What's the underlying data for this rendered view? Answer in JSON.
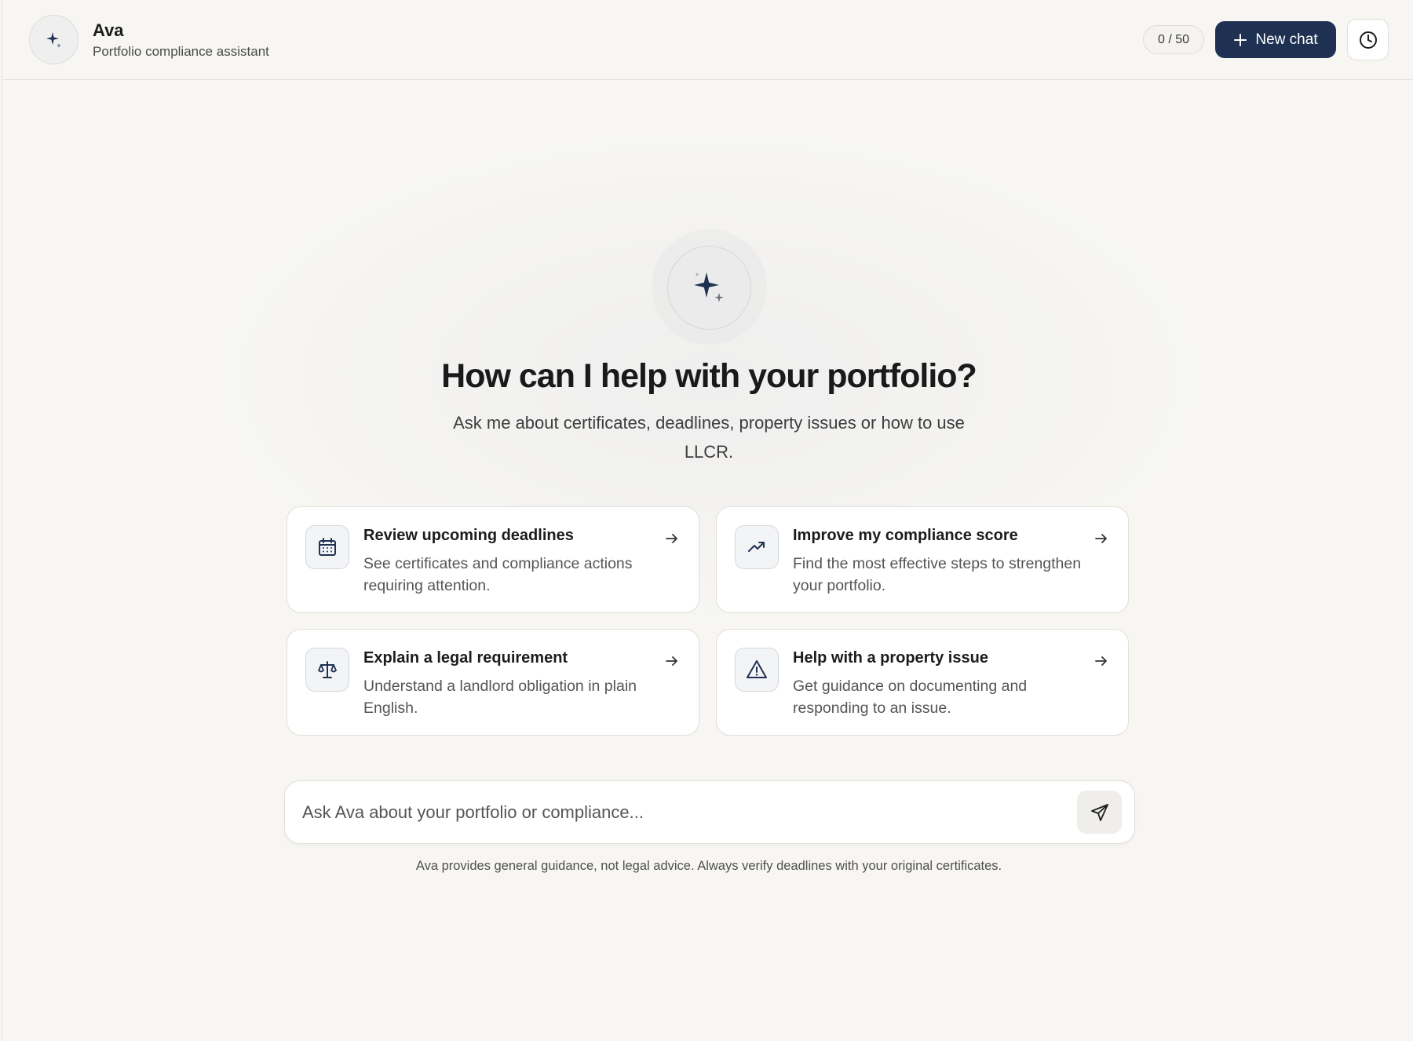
{
  "header": {
    "title": "Ava",
    "subtitle": "Portfolio compliance assistant",
    "counter": "0 / 50",
    "new_chat_label": "New chat",
    "icons": {
      "avatar": "sparkle-icon",
      "new_chat": "plus-icon",
      "history": "clock-icon"
    }
  },
  "hero": {
    "title": "How can I help with your portfolio?",
    "subtitle": "Ask me about certificates, deadlines, property issues or how to use LLCR."
  },
  "suggestions": [
    {
      "title": "Review upcoming deadlines",
      "description": "See certificates and compliance actions requiring attention.",
      "icon": "calendar-icon"
    },
    {
      "title": "Improve my compliance score",
      "description": "Find the most effective steps to strengthen your portfolio.",
      "icon": "trending-up-icon"
    },
    {
      "title": "Explain a legal requirement",
      "description": "Understand a landlord obligation in plain English.",
      "icon": "scale-icon"
    },
    {
      "title": "Help with a property issue",
      "description": "Get guidance on documenting and responding to an issue.",
      "icon": "warning-icon"
    }
  ],
  "composer": {
    "placeholder": "Ask Ava about your portfolio or compliance...",
    "send_icon": "send-icon"
  },
  "disclaimer": "Ava provides general guidance, not legal advice. Always verify deadlines with your original certificates.",
  "colors": {
    "accent": "#1f3152",
    "background": "#f7f6f3",
    "card": "#ffffff"
  }
}
